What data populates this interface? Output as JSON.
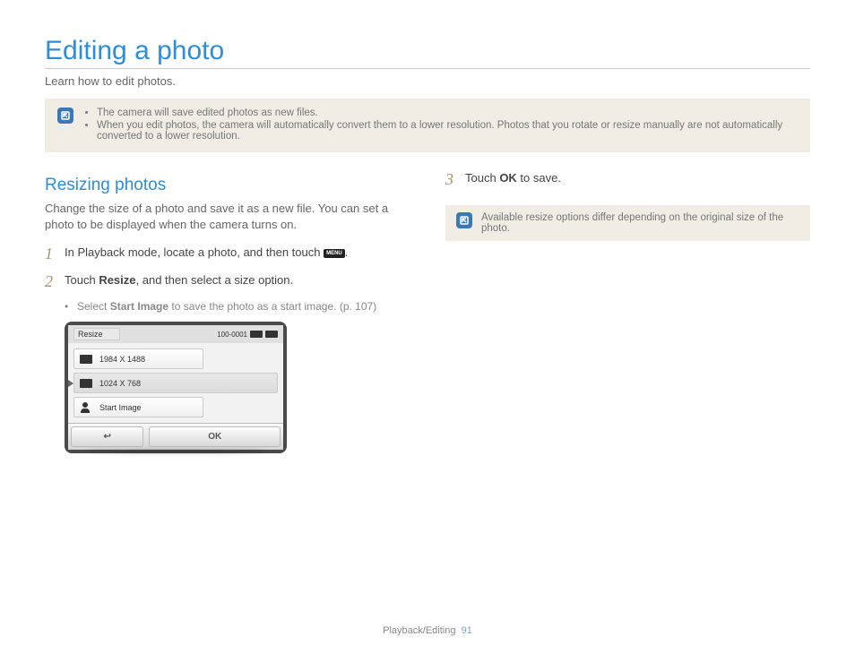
{
  "title": "Editing a photo",
  "intro": "Learn how to edit photos.",
  "top_note": {
    "items": [
      "The camera will save edited photos as new files.",
      "When you edit photos, the camera will automatically convert them to a lower resolution. Photos that you rotate or resize manually are not automatically converted to a lower resolution."
    ]
  },
  "section_heading": "Resizing photos",
  "section_desc": "Change the size of a photo and save it as a new file. You can set a photo to be displayed when the camera turns on.",
  "steps": {
    "s1_pre": "In Playback mode, locate a photo, and then touch ",
    "s1_post": ".",
    "s2_pre": "Touch ",
    "s2_bold": "Resize",
    "s2_post": ", and then select a size option.",
    "s2_sub_pre": "Select ",
    "s2_sub_bold": "Start Image",
    "s2_sub_post": " to save the photo as a start image. (p. 107)",
    "s3_pre": "Touch ",
    "s3_ok": "OK",
    "s3_post": " to save."
  },
  "screen": {
    "title": "Resize",
    "file_no": "100-0001",
    "options": [
      "1984 X 1488",
      "1024 X 768",
      "Start Image"
    ],
    "back": "↩",
    "ok": "OK"
  },
  "side_note": "Available resize options differ depending on the original size of the photo.",
  "footer_section": "Playback/Editing",
  "footer_page": "91",
  "menu_label": "MENU"
}
